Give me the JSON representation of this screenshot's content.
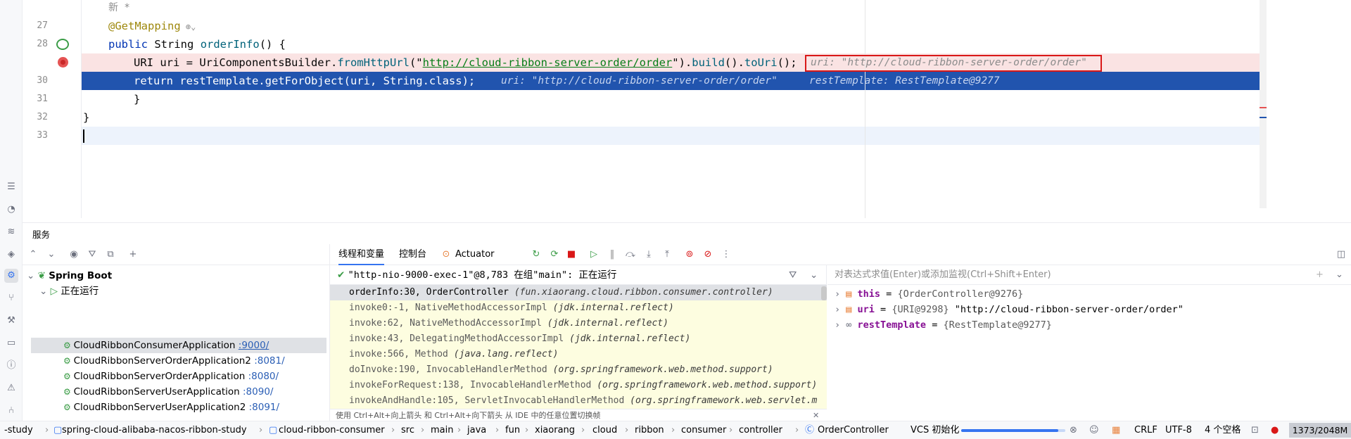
{
  "editor": {
    "line_numbers": [
      "27",
      "28",
      "",
      "30",
      "31",
      "32",
      "33"
    ],
    "author_hint": "新 *",
    "annotation": "@GetMapping",
    "line_28": {
      "kw": "public",
      "type": "String",
      "method": "orderInfo",
      "rest": "() {"
    },
    "line_29": {
      "type": "URI",
      "var": " uri = ",
      "cls": "UriComponentsBuilder",
      "dot": ".",
      "m1": "fromHttpUrl",
      "open": "(\"",
      "url": "http://cloud-ribbon-server-order/order",
      "close": "\").",
      "m2": "build",
      "p2": "().",
      "m3": "toUri",
      "end": "();"
    },
    "inline_value_box": "uri: \"http://cloud-ribbon-server-order/order\"",
    "line_30": {
      "code": "return restTemplate.getForObject(uri, String.class);",
      "inlay1": "uri: \"http://cloud-ribbon-server-order/order\"",
      "inlay2": "restTemplate: RestTemplate@9277"
    },
    "line_31": "}",
    "line_32": "}"
  },
  "services": {
    "title": "服务",
    "tree": {
      "root": "Spring Boot",
      "group": "正在运行",
      "apps": [
        {
          "name": "CloudRibbonConsumerApplication",
          "port": ":9000/"
        },
        {
          "name": "CloudRibbonServerOrderApplication2",
          "port": ":8081/"
        },
        {
          "name": "CloudRibbonServerOrderApplication",
          "port": ":8080/"
        },
        {
          "name": "CloudRibbonServerUserApplication",
          "port": ":8090/"
        },
        {
          "name": "CloudRibbonServerUserApplication2",
          "port": ":8091/"
        }
      ]
    }
  },
  "debugger": {
    "tabs": {
      "threads_vars": "线程和变量",
      "console": "控制台",
      "actuator": "Actuator"
    },
    "thread": "\"http-nio-9000-exec-1\"@8,783 在组\"main\": 正在运行",
    "frames": [
      {
        "method": "orderInfo:30, OrderController",
        "pkg": "(fun.xiaorang.cloud.ribbon.consumer.controller)"
      },
      {
        "method": "invoke0:-1, NativeMethodAccessorImpl",
        "pkg": "(jdk.internal.reflect)"
      },
      {
        "method": "invoke:62, NativeMethodAccessorImpl",
        "pkg": "(jdk.internal.reflect)"
      },
      {
        "method": "invoke:43, DelegatingMethodAccessorImpl",
        "pkg": "(jdk.internal.reflect)"
      },
      {
        "method": "invoke:566, Method",
        "pkg": "(java.lang.reflect)"
      },
      {
        "method": "doInvoke:190, InvocableHandlerMethod",
        "pkg": "(org.springframework.web.method.support)"
      },
      {
        "method": "invokeForRequest:138, InvocableHandlerMethod",
        "pkg": "(org.springframework.web.method.support)"
      },
      {
        "method": "invokeAndHandle:105, ServletInvocableHandlerMethod",
        "pkg": "(org.springframework.web.servlet.m"
      }
    ],
    "frames_hint": "使用 Ctrl+Alt+向上箭头 和 Ctrl+Alt+向下箭头 从 IDE 中的任意位置切换帧",
    "eval_placeholder": "对表达式求值(Enter)或添加监视(Ctrl+Shift+Enter)",
    "vars": [
      {
        "name": "this",
        "eq": " = ",
        "ref": "{OrderController@9276}",
        "val": ""
      },
      {
        "name": "uri",
        "eq": " = ",
        "ref": "{URI@9298}",
        "val": " \"http://cloud-ribbon-server-order/order\""
      },
      {
        "name": "restTemplate",
        "eq": " = ",
        "ref": "{RestTemplate@9277}",
        "val": ""
      }
    ]
  },
  "statusbar": {
    "crumbs": [
      "-study",
      "spring-cloud-alibaba-nacos-ribbon-study",
      "cloud-ribbon-consumer",
      "src",
      "main",
      "java",
      "fun",
      "xiaorang",
      "cloud",
      "ribbon",
      "consumer",
      "controller",
      "OrderController"
    ],
    "vcs": "VCS 初始化",
    "vcs_progress": 0.93,
    "line_sep": "CRLF",
    "encoding": "UTF-8",
    "indent": "4 个空格",
    "memory": "1373/2048M"
  },
  "colors": {
    "accent": "#3574f0",
    "exec_line": "#2154ae",
    "breakpoint": "#e55353",
    "highlight_box": "#d91818"
  }
}
